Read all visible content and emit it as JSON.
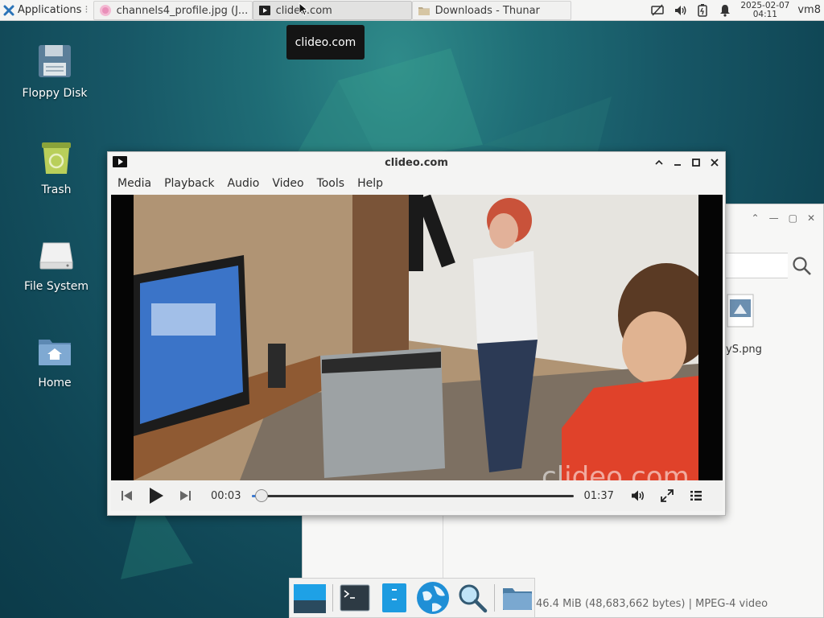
{
  "panel": {
    "applications_label": "Applications",
    "tasks": [
      {
        "label": "channels4_profile.jpg (J...",
        "icon": "image-viewer-icon"
      },
      {
        "label": "clideo.com",
        "icon": "vlc-icon"
      },
      {
        "label": "Downloads - Thunar",
        "icon": "folder-icon"
      }
    ],
    "clock_date": "2025-02-07",
    "clock_time": "04:11",
    "host": "vm8"
  },
  "tooltip": "clideo.com",
  "desktop_icons": [
    {
      "label": "Floppy Disk",
      "icon": "floppy-icon"
    },
    {
      "label": "Trash",
      "icon": "trash-icon"
    },
    {
      "label": "File System",
      "icon": "drive-icon"
    },
    {
      "label": "Home",
      "icon": "home-folder-icon"
    }
  ],
  "vlc": {
    "title": "clideo.com",
    "menu": [
      "Media",
      "Playback",
      "Audio",
      "Video",
      "Tools",
      "Help"
    ],
    "elapsed": "00:03",
    "duration": "01:37",
    "progress": 0.03,
    "watermark": "clideo.com"
  },
  "thunar": {
    "file_label": "yS.png",
    "status": "46.4 MiB (48,683,662 bytes)  |  MPEG-4 video"
  },
  "dock": [
    "show-desktop-icon",
    "terminal-icon",
    "file-manager-icon",
    "web-browser-icon",
    "app-finder-icon",
    "home-folder-icon"
  ],
  "colors": {
    "accent": "#3a7bd5",
    "tooltip_bg": "#141414",
    "desktop": "#175766"
  }
}
